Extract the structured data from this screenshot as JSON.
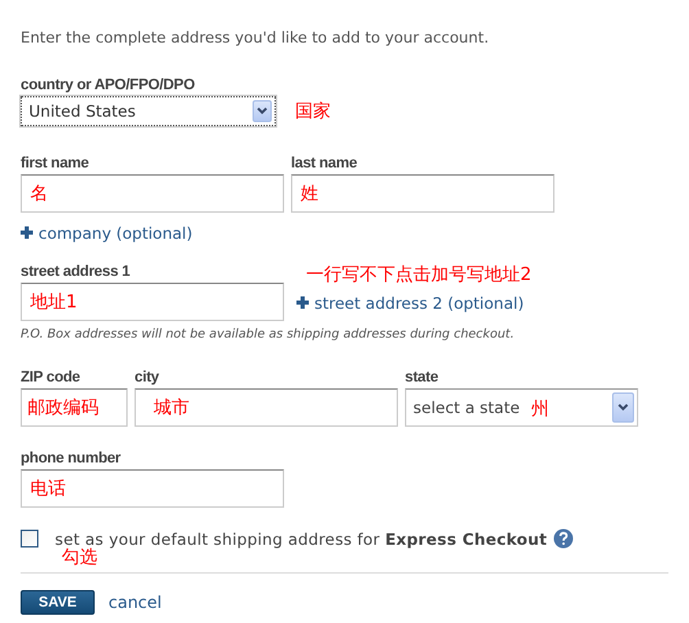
{
  "intro": "Enter the complete address you'd like to add to your account.",
  "country": {
    "label": "country or APO/FPO/DPO",
    "value": "United States",
    "note": "国家"
  },
  "first_name": {
    "label": "first name",
    "value": "名"
  },
  "last_name": {
    "label": "last name",
    "value": "姓"
  },
  "company_link": "company (optional)",
  "street1": {
    "label": "street address 1",
    "value": "地址1"
  },
  "street2_link": "street address 2 (optional)",
  "street2_note": "一行写不下点击加号写地址2",
  "po_note": "P.O. Box addresses will not be available as shipping addresses during checkout.",
  "zip": {
    "label": "ZIP code",
    "value": "邮政编码"
  },
  "city": {
    "label": "city",
    "value": "城市"
  },
  "state": {
    "label": "state",
    "placeholder": "select a state",
    "note": "州"
  },
  "phone": {
    "label": "phone number",
    "value": "电话"
  },
  "default_checkbox": {
    "label": "set as your default shipping address for **Express Checkout**",
    "checked": false,
    "note": "勾选"
  },
  "save": "SAVE",
  "cancel": "cancel"
}
